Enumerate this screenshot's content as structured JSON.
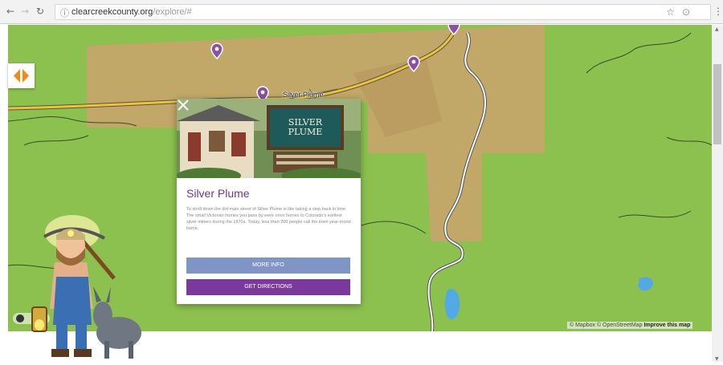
{
  "browser": {
    "url_domain": "clearcreekcounty.org",
    "url_path": "/explore/#"
  },
  "map": {
    "place_label": "Silver Plume",
    "attribution_a": "© Mapbox © OpenStreetMap",
    "attribution_b": "Improve this map"
  },
  "popup": {
    "sign_line1": "SILVER",
    "sign_line2": "PLUME",
    "title": "Silver Plume",
    "description": "To stroll down the dirt main street of Silver Plume is like taking a step back in time. The small Victorian homes you pass by were once homes to Colorado's earliest silver miners during the 1870s. Today, less than 200 people call the town year-round home.",
    "more_info_label": "MORE INFO",
    "directions_label": "GET DIRECTIONS"
  },
  "colors": {
    "grass": "#8cc04f",
    "land_tan": "#c6a56a",
    "highway": "#f2c230",
    "marker": "#8e4fa2",
    "title_purple": "#6b3b8f",
    "more_info_button": "#7f95c6",
    "directions_button": "#7b3a9b",
    "water": "#52a9e6"
  }
}
